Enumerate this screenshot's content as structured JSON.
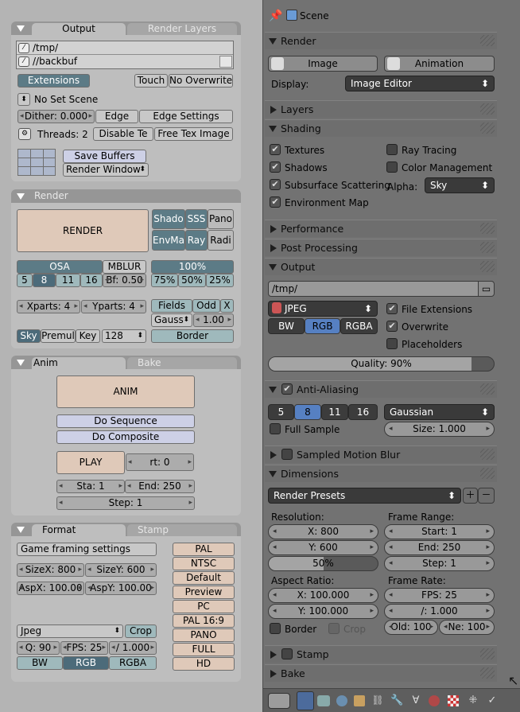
{
  "left": {
    "output": {
      "tabs": [
        "Output",
        "Render Layers"
      ],
      "paths": [
        "/tmp/",
        "//backbuf"
      ],
      "extensions_label": "Extensions",
      "touch_label": "Touch",
      "no_overwrite_label": "No Overwrite",
      "scene_select": "No Set Scene",
      "dither": "Dither: 0.000",
      "edge_label": "Edge",
      "edge_settings_label": "Edge Settings",
      "threads": "Threads: 2",
      "disable_tex_label": "Disable Te",
      "free_tex_label": "Free Tex Image",
      "save_buffers_label": "Save Buffers",
      "render_window": "Render Window"
    },
    "render": {
      "title": "Render",
      "render_button": "RENDER",
      "grid": [
        "Shado",
        "SSS",
        "Pano",
        "EnvMa",
        "Ray",
        "Radi"
      ],
      "osa_label": "OSA",
      "osa_values": [
        "5",
        "8",
        "11",
        "16"
      ],
      "mblur_label": "MBLUR",
      "bf": "Bf: 0.50",
      "percent_label": "100%",
      "percent_values": [
        "75%",
        "50%",
        "25%"
      ],
      "xparts": "Xparts: 4",
      "yparts": "Yparts: 4",
      "fields_label": "Fields",
      "odd_label": "Odd",
      "x_label": "X",
      "gauss": "Gauss",
      "gauss_value": "1.00",
      "sky_label": "Sky",
      "premul_label": "Premul",
      "key_label": "Key",
      "depth": "128",
      "border_label": "Border"
    },
    "anim": {
      "tabs": [
        "Anim",
        "Bake"
      ],
      "anim_button": "ANIM",
      "do_sequence": "Do Sequence",
      "do_composite": "Do Composite",
      "play": "PLAY",
      "rt": "rt: 0",
      "sta": "Sta: 1",
      "end": "End: 250",
      "step": "Step: 1"
    },
    "format": {
      "tabs": [
        "Format",
        "Stamp"
      ],
      "game_framing": "Game framing settings",
      "sizex": "SizeX: 800",
      "sizey": "SizeY: 600",
      "aspx": "AspX: 100.00",
      "aspy": "AspY: 100.00",
      "presets": [
        "PAL",
        "NTSC",
        "Default",
        "Preview",
        "PC",
        "PAL 16:9",
        "PANO",
        "FULL",
        "HD"
      ],
      "file_format": "Jpeg",
      "crop_label": "Crop",
      "quality": "Q: 90",
      "fps": "FPS: 25",
      "fps_base": "/ 1.000",
      "channels": [
        "BW",
        "RGB",
        "RGBA"
      ]
    }
  },
  "right": {
    "header_title": "Scene",
    "render": {
      "title": "Render",
      "image_label": "Image",
      "animation_label": "Animation",
      "display_label": "Display:",
      "display_value": "Image Editor"
    },
    "layers_title": "Layers",
    "shading": {
      "title": "Shading",
      "textures": "Textures",
      "shadows": "Shadows",
      "sss": "Subsurface Scattering",
      "envmap": "Environment Map",
      "raytracing": "Ray Tracing",
      "color_mgmt": "Color Management",
      "alpha_label": "Alpha:",
      "alpha_value": "Sky"
    },
    "performance_title": "Performance",
    "post_processing_title": "Post Processing",
    "output": {
      "title": "Output",
      "path": "/tmp/",
      "format": "JPEG",
      "channels": [
        "BW",
        "RGB",
        "RGBA"
      ],
      "file_extensions": "File Extensions",
      "overwrite": "Overwrite",
      "placeholders": "Placeholders",
      "quality": "Quality: 90%",
      "quality_fraction": 0.9
    },
    "antialiasing": {
      "title": "Anti-Aliasing",
      "samples": [
        "5",
        "8",
        "11",
        "16"
      ],
      "filter": "Gaussian",
      "full_sample": "Full Sample",
      "size": "Size: 1.000"
    },
    "motion_blur_title": "Sampled Motion Blur",
    "dimensions": {
      "title": "Dimensions",
      "presets": "Render Presets",
      "resolution_label": "Resolution:",
      "x": "X: 800",
      "y": "Y: 600",
      "percent": "50%",
      "frame_range_label": "Frame Range:",
      "start": "Start: 1",
      "end": "End: 250",
      "step": "Step: 1",
      "aspect_label": "Aspect Ratio:",
      "ax": "X: 100.000",
      "ay": "Y: 100.000",
      "frame_rate_label": "Frame Rate:",
      "fps": "FPS: 25",
      "fps_base": "/: 1.000",
      "border": "Border",
      "crop": "Crop",
      "old": "Old: 100",
      "new": "Ne: 100"
    },
    "stamp_title": "Stamp",
    "bake_title": "Bake"
  },
  "colors": {
    "accent_blue": "#5680c2",
    "tan": "#dfc9b9",
    "teal": "#5c7b86"
  }
}
